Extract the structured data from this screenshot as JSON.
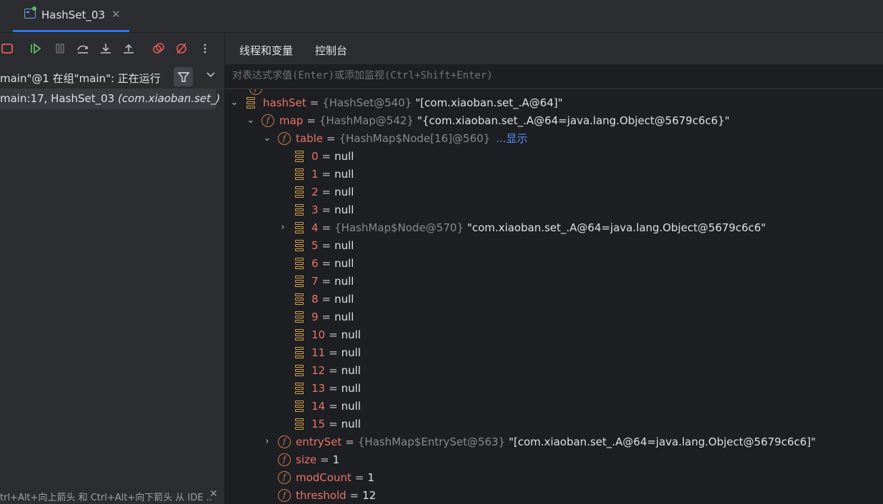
{
  "tab": {
    "title": "HashSet_03",
    "close": "✕"
  },
  "left": {
    "thread": "main\"@1 在组\"main\": 正在运行",
    "frame_prefix": "main:17, HashSet_03 ",
    "frame_pkg": "(com.xiaoban.set_)",
    "hint": "trl+Alt+向上箭头 和 Ctrl+Alt+向下箭头 从 IDE ..",
    "hint_close": "✕"
  },
  "right": {
    "tabs": [
      "线程和变量",
      "控制台"
    ],
    "eval_placeholder": "对表达式求值(Enter)或添加监视(Ctrl+Shift+Enter)"
  },
  "tree": {
    "hashSet": {
      "name": "hashSet",
      "type": "{HashSet@540}",
      "value": "\"[com.xiaoban.set_.A@64]\""
    },
    "map": {
      "name": "map",
      "type": "{HashMap@542}",
      "value": "\"{com.xiaoban.set_.A@64=java.lang.Object@5679c6c6}\""
    },
    "table": {
      "name": "table",
      "type": "{HashMap$Node[16]@560}",
      "link": "...显示"
    },
    "entries": [
      {
        "idx": "0",
        "val": "null"
      },
      {
        "idx": "1",
        "val": "null"
      },
      {
        "idx": "2",
        "val": "null"
      },
      {
        "idx": "3",
        "val": "null"
      },
      {
        "idx": "4",
        "type": "{HashMap$Node@570}",
        "val": "\"com.xiaoban.set_.A@64=java.lang.Object@5679c6c6\""
      },
      {
        "idx": "5",
        "val": "null"
      },
      {
        "idx": "6",
        "val": "null"
      },
      {
        "idx": "7",
        "val": "null"
      },
      {
        "idx": "8",
        "val": "null"
      },
      {
        "idx": "9",
        "val": "null"
      },
      {
        "idx": "10",
        "val": "null"
      },
      {
        "idx": "11",
        "val": "null"
      },
      {
        "idx": "12",
        "val": "null"
      },
      {
        "idx": "13",
        "val": "null"
      },
      {
        "idx": "14",
        "val": "null"
      },
      {
        "idx": "15",
        "val": "null"
      }
    ],
    "entrySet": {
      "name": "entrySet",
      "type": "{HashMap$EntrySet@563}",
      "value": "\"[com.xiaoban.set_.A@64=java.lang.Object@5679c6c6]\""
    },
    "size": {
      "name": "size",
      "value": "1"
    },
    "modCount": {
      "name": "modCount",
      "value": "1"
    },
    "threshold": {
      "name": "threshold",
      "value": "12"
    }
  },
  "colors": {
    "accent": "#3574f0",
    "field_name": "#e8746a",
    "field_icon": "#c77c54",
    "array_icon": "#d2a24c",
    "link": "#548af7"
  }
}
